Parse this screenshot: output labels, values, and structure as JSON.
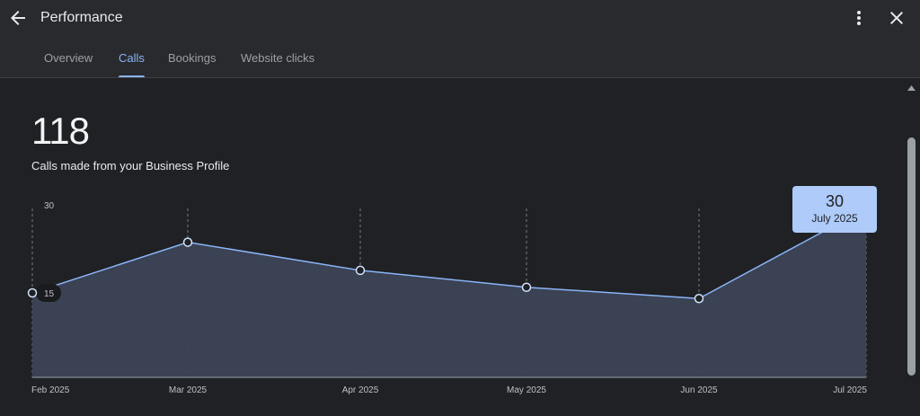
{
  "header": {
    "title": "Performance",
    "back_icon": "arrow-back-icon",
    "more_icon": "more-vert-icon",
    "close_icon": "close-icon"
  },
  "tabs": [
    {
      "label": "Overview",
      "active": false
    },
    {
      "label": "Calls",
      "active": true
    },
    {
      "label": "Bookings",
      "active": false
    },
    {
      "label": "Website clicks",
      "active": false
    }
  ],
  "summary": {
    "total": "118",
    "caption": "Calls made from your Business Profile"
  },
  "tooltip": {
    "value": "30",
    "label": "July 2025"
  },
  "colors": {
    "accent": "#8ab4f8",
    "tooltip_bg": "#aecbfa",
    "area_fill": "#3c4556",
    "background": "#202124"
  },
  "chart_data": {
    "type": "area",
    "x": [
      "Feb 2025",
      "Mar 2025",
      "Apr 2025",
      "May 2025",
      "Jun 2025",
      "Jul 2025"
    ],
    "values": [
      15,
      24,
      19,
      16,
      14,
      30
    ],
    "ylim": [
      0,
      30
    ],
    "y_ticks": [
      "15",
      "30"
    ],
    "highlight_index": 5,
    "grid": "vertical-dashed"
  }
}
